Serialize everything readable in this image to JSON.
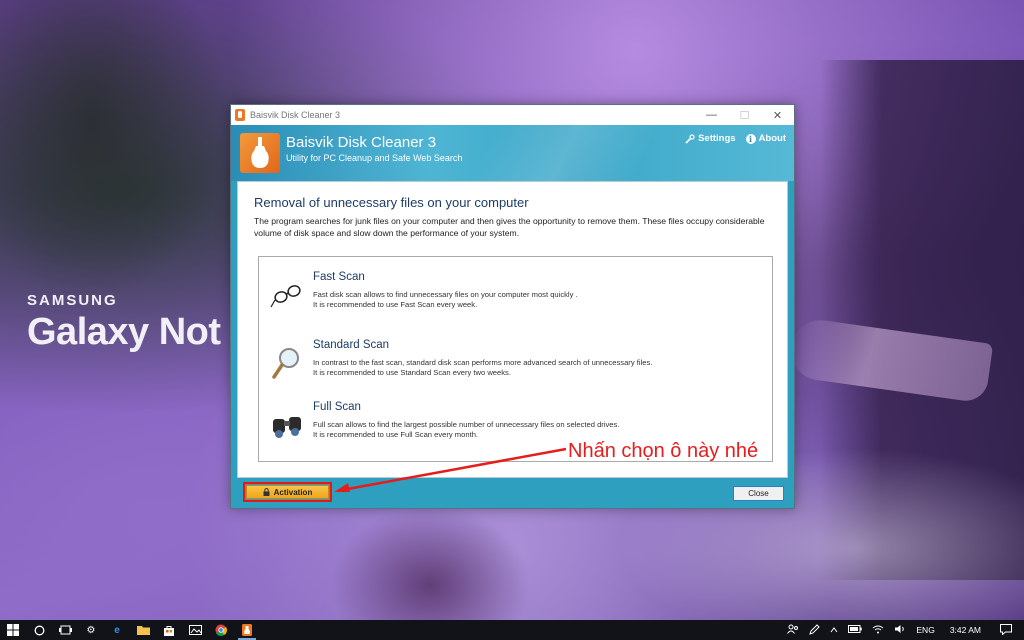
{
  "wallpaper": {
    "brand_top": "SAMSUNG",
    "brand_bottom": "Galaxy Not"
  },
  "window": {
    "titlebar_text": "Baisvik Disk Cleaner 3",
    "controls": {
      "minimize": "—",
      "maximize": "☐",
      "close": "✕"
    },
    "app_title": "Baisvik Disk Cleaner 3",
    "app_subtitle": "Utility for PC Cleanup and Safe Web Search",
    "settings_label": "Settings",
    "about_label": "About",
    "heading": "Removal of unnecessary files on your computer",
    "description": "The program searches for junk files on your computer and then gives the opportunity to remove them. These files occupy considerable volume of disk space and slow down the performance of your system.",
    "scans": [
      {
        "title": "Fast Scan",
        "line1": "Fast disk scan allows to find unnecessary files on your computer most quickly .",
        "line2": "It is recommended to use Fast Scan every week.",
        "icon": "glasses-icon"
      },
      {
        "title": "Standard Scan",
        "line1": "In contrast to the fast scan, standard disk scan performs more advanced search of unnecessary files.",
        "line2": "It is recommended to use Standard Scan every two weeks.",
        "icon": "magnifier-icon"
      },
      {
        "title": "Full Scan",
        "line1": "Full scan allows to find the largest possible number of unnecessary files on selected drives.",
        "line2": "It is recommended to use Full Scan every month.",
        "icon": "binoculars-icon"
      }
    ],
    "activation_label": "Activation",
    "close_label": "Close"
  },
  "annotation": {
    "text": "Nhấn chọn ô này nhé",
    "color": "#e51d1d"
  },
  "taskbar": {
    "language": "ENG",
    "time": "3:42 AM"
  }
}
